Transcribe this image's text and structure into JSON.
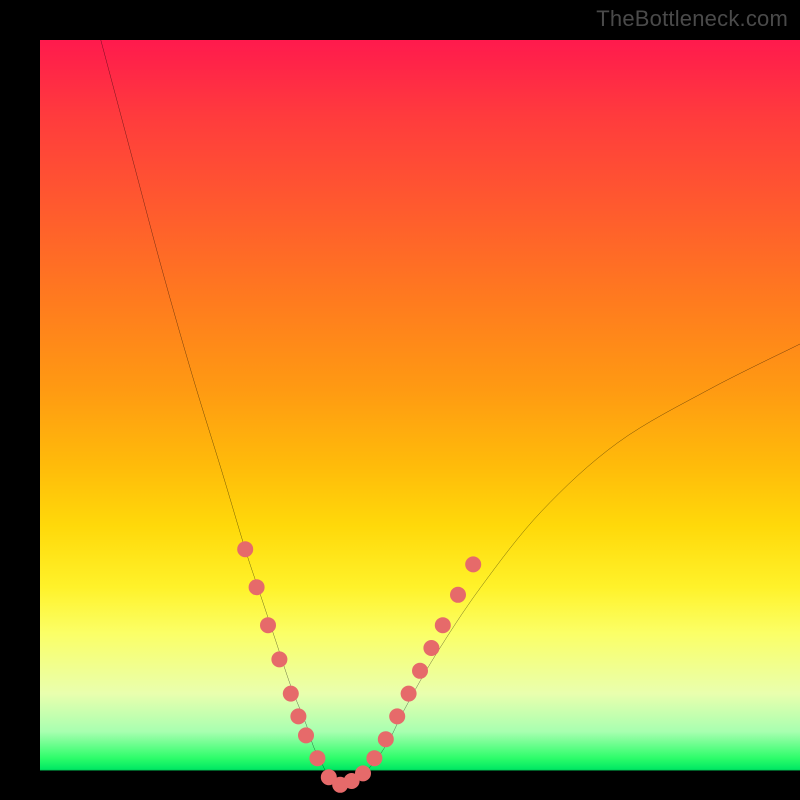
{
  "watermark": "TheBottleneck.com",
  "chart_data": {
    "type": "line",
    "title": "",
    "xlabel": "",
    "ylabel": "",
    "xlim": [
      0,
      100
    ],
    "ylim": [
      0,
      100
    ],
    "grid": false,
    "legend": false,
    "series": [
      {
        "name": "bottleneck-curve",
        "color": "#000000",
        "x": [
          8,
          12,
          16,
          20,
          24,
          27,
          29,
          31,
          33,
          35,
          36,
          37,
          38,
          39,
          40,
          42,
          44,
          46,
          48,
          52,
          58,
          66,
          76,
          88,
          100
        ],
        "y": [
          100,
          85,
          70,
          56,
          43,
          33,
          27,
          21,
          15,
          10,
          7,
          5,
          3,
          2,
          2,
          3,
          5,
          8,
          12,
          19,
          28,
          38,
          47,
          54,
          60
        ]
      }
    ],
    "markers": [
      {
        "name": "highlight-points-left-branch",
        "color": "#e66a6a",
        "radius": 8,
        "points": [
          {
            "x": 27,
            "y": 33
          },
          {
            "x": 28.5,
            "y": 28
          },
          {
            "x": 30,
            "y": 23
          },
          {
            "x": 31.5,
            "y": 18.5
          },
          {
            "x": 33,
            "y": 14
          },
          {
            "x": 34,
            "y": 11
          },
          {
            "x": 35,
            "y": 8.5
          },
          {
            "x": 36.5,
            "y": 5.5
          },
          {
            "x": 38,
            "y": 3
          },
          {
            "x": 39.5,
            "y": 2
          }
        ]
      },
      {
        "name": "highlight-points-right-branch",
        "color": "#e66a6a",
        "radius": 8,
        "points": [
          {
            "x": 41,
            "y": 2.5
          },
          {
            "x": 42.5,
            "y": 3.5
          },
          {
            "x": 44,
            "y": 5.5
          },
          {
            "x": 45.5,
            "y": 8
          },
          {
            "x": 47,
            "y": 11
          },
          {
            "x": 48.5,
            "y": 14
          },
          {
            "x": 50,
            "y": 17
          },
          {
            "x": 51.5,
            "y": 20
          },
          {
            "x": 53,
            "y": 23
          },
          {
            "x": 55,
            "y": 27
          },
          {
            "x": 57,
            "y": 31
          }
        ]
      }
    ]
  }
}
